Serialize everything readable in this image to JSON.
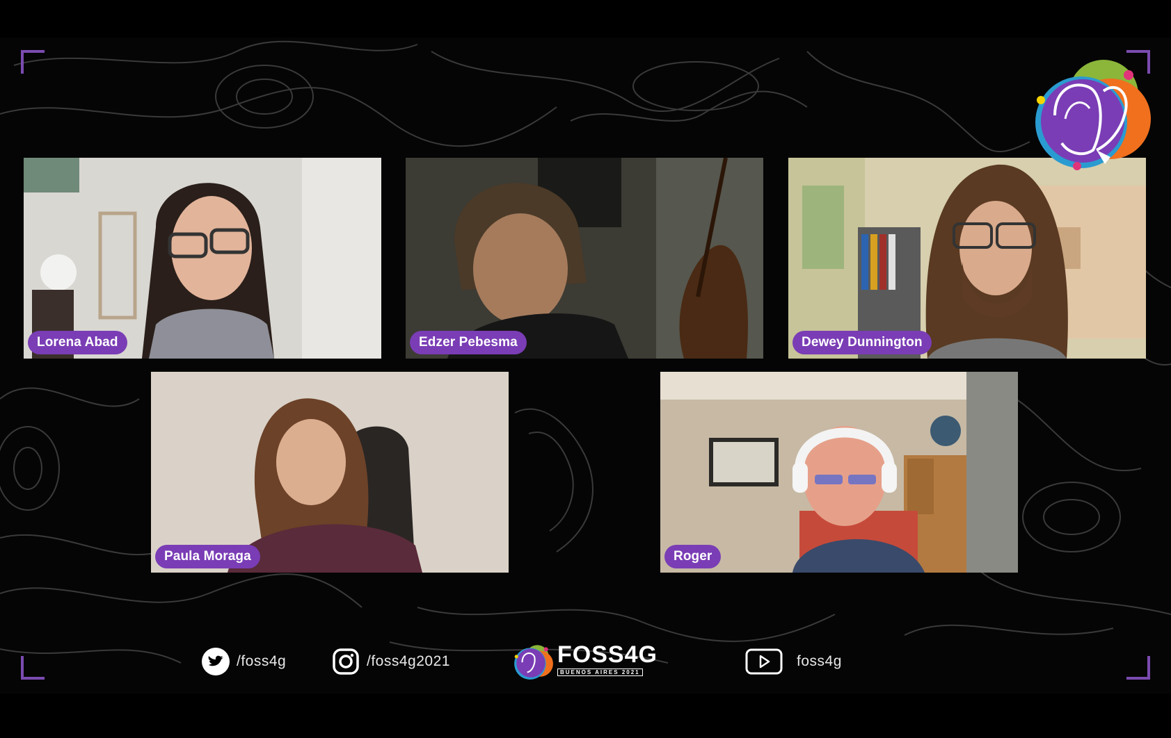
{
  "participants": [
    {
      "name": "Lorena Abad"
    },
    {
      "name": "Edzer Pebesma"
    },
    {
      "name": "Dewey Dunnington"
    },
    {
      "name": "Paula Moraga"
    },
    {
      "name": "Roger"
    }
  ],
  "footer": {
    "twitter": {
      "icon": "twitter-icon",
      "handle": "/foss4g"
    },
    "instagram": {
      "icon": "instagram-icon",
      "handle": "/foss4g2021"
    },
    "brand": {
      "wordmark": "FOSS4G",
      "subtitle": "BUENOS AIRES 2021"
    },
    "youtube": {
      "icon": "youtube-icon",
      "handle": "foss4g"
    }
  },
  "colors": {
    "accent": "#7a3db5",
    "background": "#000000",
    "logo_green": "#8bb63a",
    "logo_orange": "#f0701e",
    "logo_pink": "#e0337a",
    "logo_yellow": "#f5d400"
  }
}
